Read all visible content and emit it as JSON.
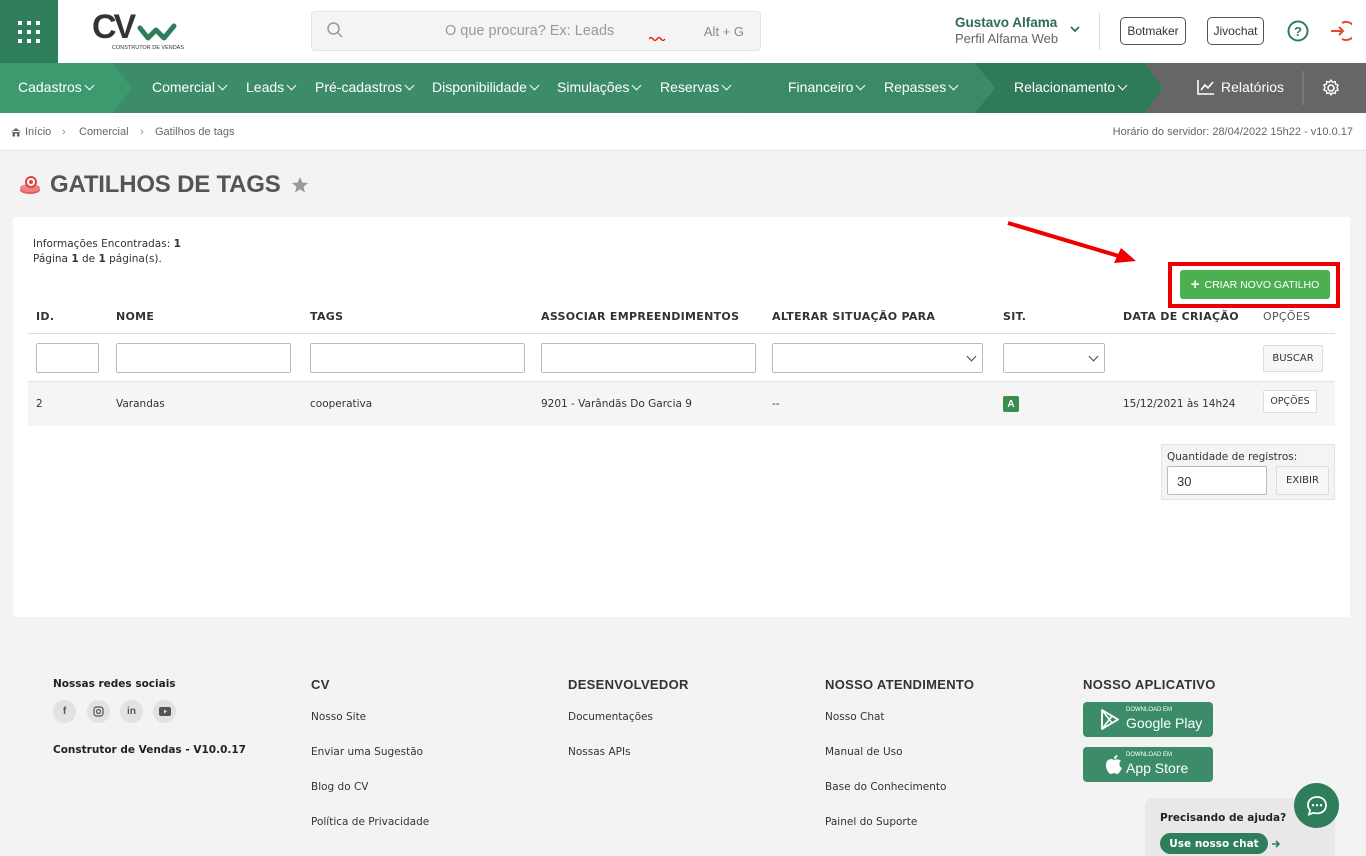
{
  "header": {
    "logo_text": "CV",
    "logo_sub": "CONSTRUTOR DE VENDAS",
    "search_placeholder": "O que procura? Ex: Leads",
    "search_shortcut": "Alt + G",
    "user_name": "Gustavo Alfama",
    "user_profile": "Perfil Alfama Web",
    "botmaker": "Botmaker",
    "jivochat": "Jivochat"
  },
  "nav": {
    "cadastros": "Cadastros",
    "comercial": "Comercial",
    "leads": "Leads",
    "precadastros": "Pré-cadastros",
    "disponibilidade": "Disponibilidade",
    "simulacoes": "Simulações",
    "reservas": "Reservas",
    "financeiro": "Financeiro",
    "repasses": "Repasses",
    "relacionamento": "Relacionamento",
    "relatorios": "Relatórios"
  },
  "breadcrumb": {
    "inicio": "Início",
    "comercial": "Comercial",
    "current": "Gatilhos de tags",
    "server_time": "Horário do servidor: 28/04/2022 15h22 - v10.0.17"
  },
  "page": {
    "title": "GATILHOS DE TAGS",
    "info_label": "Informações Encontradas:",
    "info_count": "1",
    "page_word": "Página",
    "page_num": "1",
    "of_word": "de",
    "page_total": "1",
    "pages_word": "página(s).",
    "create_button": "CRIAR NOVO GATILHO"
  },
  "table": {
    "headers": [
      "ID.",
      "NOME",
      "TAGS",
      "ASSOCIAR EMPREENDIMENTOS",
      "ALTERAR SITUAÇÃO PARA",
      "SIT.",
      "DATA DE CRIAÇÃO",
      "OPÇÕES"
    ],
    "search_button": "BUSCAR",
    "rows": [
      {
        "id": "2",
        "nome": "Varandas",
        "tags": "cooperativa",
        "empreendimento": "9201 - Varândãs Do Garcia 9",
        "situacao_para": "--",
        "sit": "A",
        "data": "15/12/2021 às 14h24",
        "opcoes": "OPÇÕES"
      }
    ],
    "qty_label": "Quantidade de registros:",
    "qty_value": "30",
    "exibir": "EXIBIR"
  },
  "footer": {
    "social_title": "Nossas redes sociais",
    "version": "Construtor de Vendas - V10.0.17",
    "cv_title": "CV",
    "cv_links": [
      "Nosso Site",
      "Enviar uma Sugestão",
      "Blog do CV",
      "Política de Privacidade"
    ],
    "dev_title": "DESENVOLVEDOR",
    "dev_links": [
      "Documentações",
      "Nossas APIs"
    ],
    "atend_title": "NOSSO ATENDIMENTO",
    "atend_links": [
      "Nosso Chat",
      "Manual de Uso",
      "Base do Conhecimento",
      "Painel do Suporte"
    ],
    "app_title": "NOSSO APLICATIVO",
    "gp_small": "DOWNLOAD EM",
    "gp_big": "Google Play",
    "as_small": "DOWNLOAD EM",
    "as_big": "App Store",
    "help_title": "Precisando de ajuda?",
    "help_button": "Use nosso chat"
  },
  "colors": {
    "brand": "#3d8c69",
    "dark_brand": "#2e7d5b",
    "create": "#4caf50",
    "highlight": "#ee0000"
  }
}
